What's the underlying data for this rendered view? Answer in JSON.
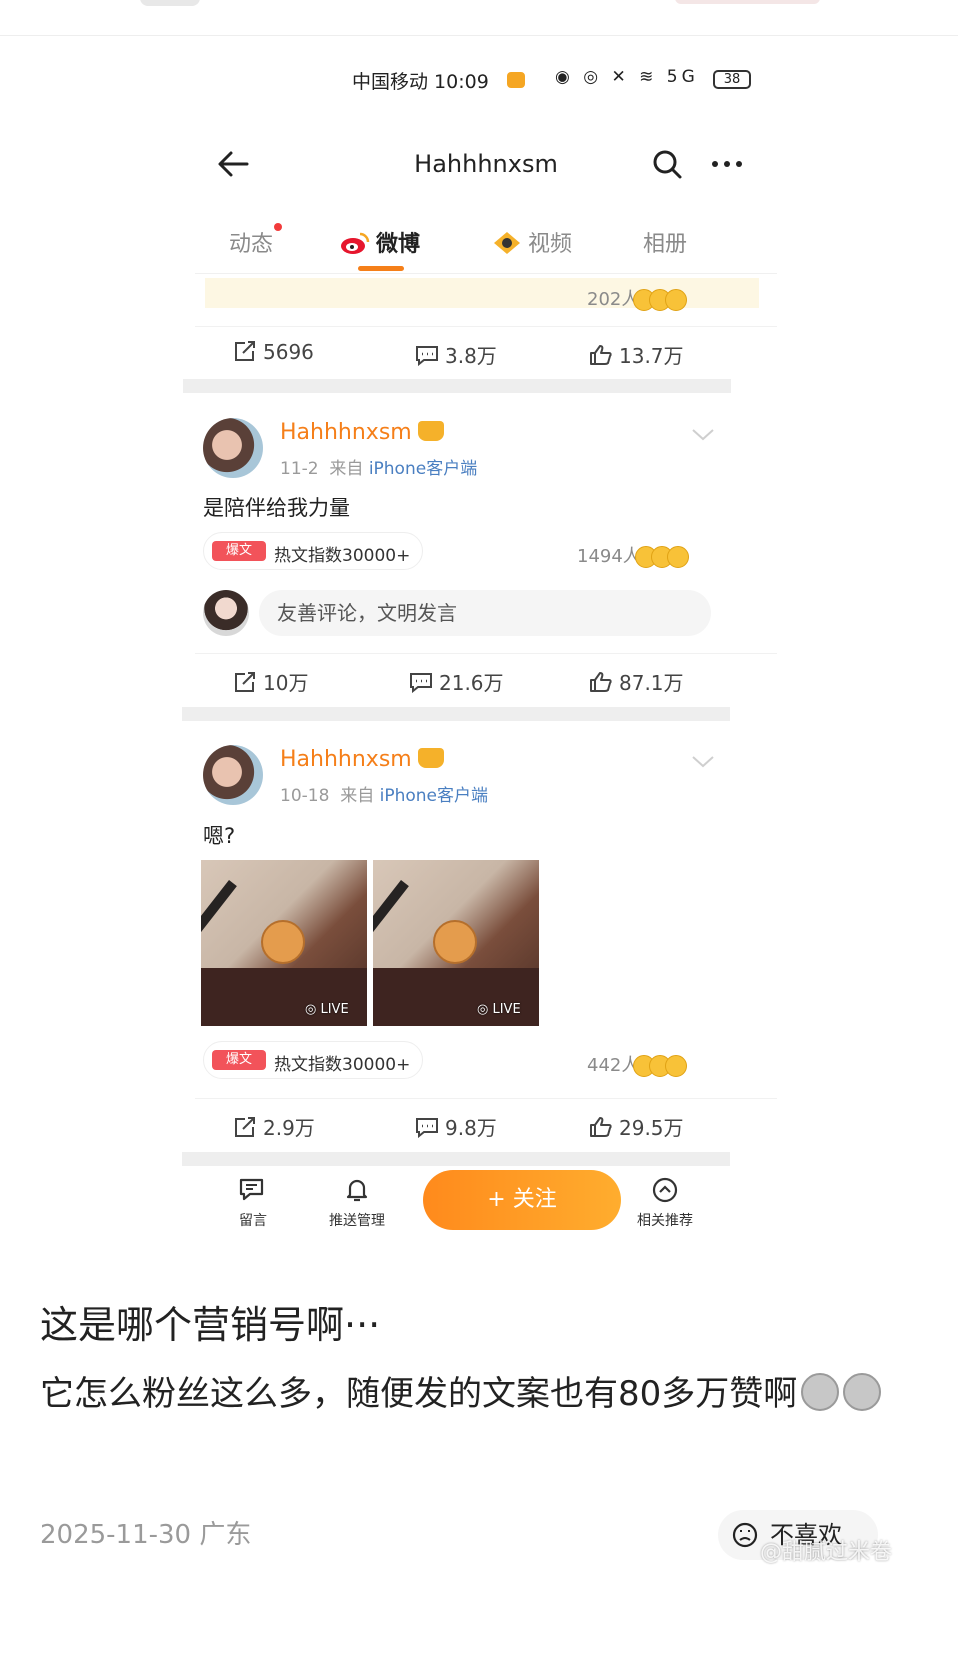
{
  "status_bar": {
    "carrier_time": "中国移动 10:09",
    "signal_icons": "◉ ◎ ✕ ≋ 5G",
    "battery": "38"
  },
  "nav": {
    "title": "Hahhhnxsm"
  },
  "tabs": [
    {
      "label": "动态"
    },
    {
      "label": "微博"
    },
    {
      "label": "视频"
    },
    {
      "label": "相册"
    }
  ],
  "prev_post": {
    "reactions": "202人",
    "forward": "5696",
    "comments": "3.8万",
    "likes": "13.7万"
  },
  "posts": [
    {
      "user": "Hahhhnxsm",
      "date": "11-2",
      "source_prefix": "来自",
      "source": "iPhone客户端",
      "text": "是陪伴给我力量",
      "hot_badge": "爆文",
      "hot_text": "热文指数30000+",
      "reactions": "1494人",
      "comment_placeholder": "友善评论，文明发言",
      "forward": "10万",
      "comments": "21.6万",
      "likes": "87.1万"
    },
    {
      "user": "Hahhhnxsm",
      "date": "10-18",
      "source_prefix": "来自",
      "source": "iPhone客户端",
      "text": "嗯?",
      "photo_label": "LIVE",
      "hot_badge": "爆文",
      "hot_text": "热文指数30000+",
      "reactions": "442人",
      "forward": "2.9万",
      "comments": "9.8万",
      "likes": "29.5万"
    }
  ],
  "bottom_bar": {
    "message": "留言",
    "push": "推送管理",
    "follow": "+ 关注",
    "related": "相关推荐"
  },
  "caption": {
    "title": "这是哪个营销号啊···",
    "body": "它怎么粉丝这么多，随便发的文案也有80多万赞啊",
    "date_location": "2025-11-30 广东",
    "dislike": "不喜欢",
    "watermark": "@甜腻过米卷"
  },
  "colors": {
    "accent": "#f57f19",
    "link": "#4a7fc1",
    "hot": "#f2535a"
  }
}
